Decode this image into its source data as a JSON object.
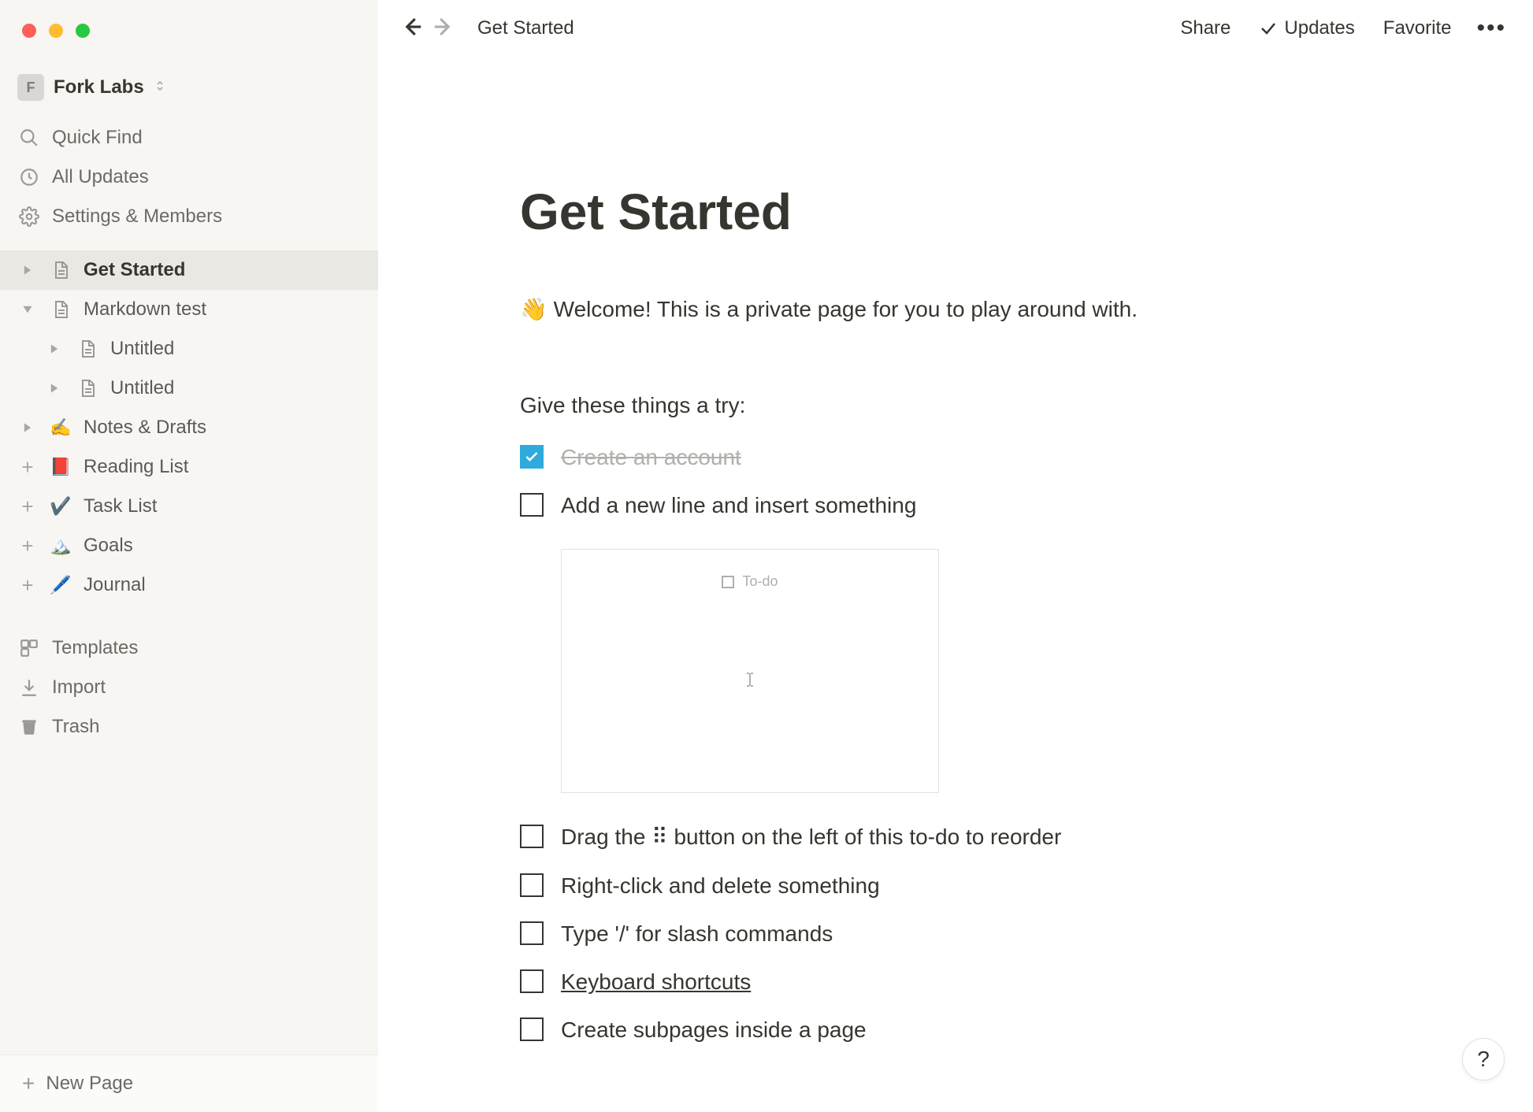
{
  "workspace": {
    "initial": "F",
    "name": "Fork Labs"
  },
  "sidebar_nav": {
    "quick_find": "Quick Find",
    "all_updates": "All Updates",
    "settings": "Settings & Members"
  },
  "sidebar_pages": [
    {
      "key": "get_started",
      "label": "Get Started",
      "icon": "doc",
      "toggle": "closed",
      "active": true,
      "depth": 0
    },
    {
      "key": "markdown",
      "label": "Markdown test",
      "icon": "doc",
      "toggle": "open",
      "active": false,
      "depth": 0
    },
    {
      "key": "untitled1",
      "label": "Untitled",
      "icon": "doc",
      "toggle": "closed",
      "active": false,
      "depth": 1
    },
    {
      "key": "untitled2",
      "label": "Untitled",
      "icon": "doc",
      "toggle": "closed",
      "active": false,
      "depth": 1
    },
    {
      "key": "notes",
      "label": "Notes & Drafts",
      "icon": "✍️",
      "toggle": "closed",
      "active": false,
      "depth": 0
    },
    {
      "key": "reading",
      "label": "Reading List",
      "icon": "📕",
      "toggle": "plus",
      "active": false,
      "depth": 0
    },
    {
      "key": "tasks",
      "label": "Task List",
      "icon": "✔️",
      "toggle": "plus",
      "active": false,
      "depth": 0
    },
    {
      "key": "goals",
      "label": "Goals",
      "icon": "🏔️",
      "toggle": "plus",
      "active": false,
      "depth": 0
    },
    {
      "key": "journal",
      "label": "Journal",
      "icon": "🖊️",
      "toggle": "plus",
      "active": false,
      "depth": 0
    }
  ],
  "sidebar_lower": {
    "templates": "Templates",
    "import": "Import",
    "trash": "Trash"
  },
  "new_page_label": "New Page",
  "topbar": {
    "breadcrumb": "Get Started",
    "share": "Share",
    "updates": "Updates",
    "favorite": "Favorite"
  },
  "page": {
    "title": "Get Started",
    "intro_emoji": "👋",
    "intro": "Welcome! This is a private page for you to play around with.",
    "subhead": "Give these things a try:",
    "todos": [
      {
        "text": "Create an account",
        "checked": true,
        "link": false
      },
      {
        "text": "Add a new line and insert something",
        "checked": false,
        "link": false
      },
      {
        "text": "Drag the ⠿ button on the left of this to-do to reorder",
        "checked": false,
        "link": false
      },
      {
        "text": "Right-click and delete something",
        "checked": false,
        "link": false
      },
      {
        "text": "Type '/' for slash commands",
        "checked": false,
        "link": false
      },
      {
        "text": "Keyboard shortcuts",
        "checked": false,
        "link": true
      },
      {
        "text": "Create subpages inside a page",
        "checked": false,
        "link": false
      }
    ],
    "embed_label": "To-do"
  },
  "help_fab": "?"
}
